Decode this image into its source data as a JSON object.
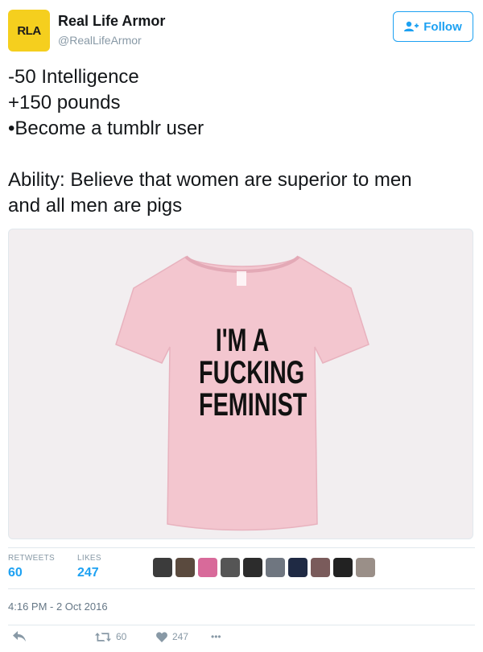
{
  "author": {
    "avatar_text": "RLA",
    "name": "Real Life Armor",
    "handle": "@RealLifeArmor",
    "avatar_color": "#f5cf1e"
  },
  "follow_button": {
    "label": "Follow",
    "icon": "add-user-icon"
  },
  "tweet": {
    "lines": [
      "-50 Intelligence",
      "+150 pounds",
      "•Become a tumblr user"
    ],
    "ability_lines": [
      "Ability: Believe that women are superior to men",
      "and all men are pigs"
    ]
  },
  "media": {
    "shirt_lines": [
      "I'M A",
      "FUCKING",
      "FEMINIST"
    ],
    "shirt_color": "#f3c6cf"
  },
  "stats": {
    "retweets_label": "RETWEETS",
    "retweets_value": "60",
    "likes_label": "LIKES",
    "likes_value": "247"
  },
  "timestamp": "4:16 PM - 2 Oct 2016",
  "actions": {
    "reply_icon": "reply-icon",
    "retweet_count": "60",
    "like_count": "247",
    "more_label": "•••"
  },
  "colors": {
    "accent": "#1da1f2",
    "muted": "#8899a6"
  }
}
